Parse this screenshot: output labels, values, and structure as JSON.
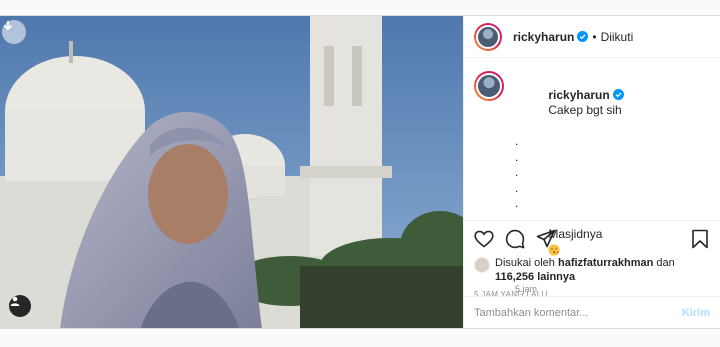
{
  "post": {
    "author": {
      "username": "rickyharun",
      "verified": true,
      "follow_status": "Diikuti",
      "separator": "•"
    },
    "caption": {
      "username": "rickyharun",
      "lines": [
        "Cakep bgt sih",
        ".",
        ".",
        ".",
        ".",
        ".",
        "Masjidnya"
      ],
      "emoji": "face-blowing-kiss",
      "time": "5 jam"
    },
    "likes": {
      "prefix": "Disukai oleh",
      "liker": "hafizfaturrakhman",
      "connector": "dan",
      "others": "116,256 lainnya"
    },
    "posted_ago": "5 JAM YANG LALU",
    "comment_box": {
      "placeholder": "Tambahkan komentar...",
      "submit_label": "Kirim"
    },
    "colors": {
      "accent_disabled": "#b2dffc",
      "verified_blue": "#0095f6",
      "muted": "#8e8e8e"
    }
  }
}
